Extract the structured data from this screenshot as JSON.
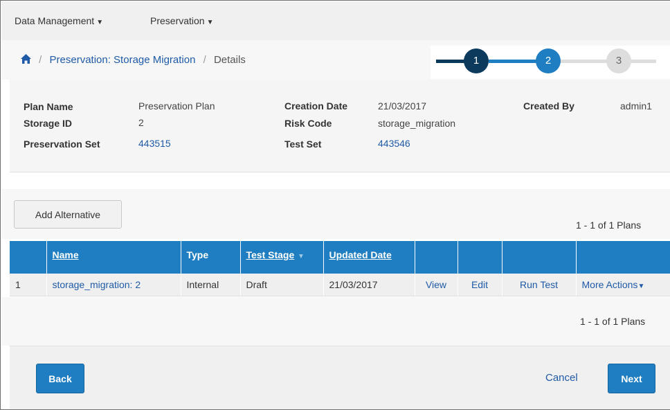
{
  "menu": {
    "items": [
      {
        "label": "Data Management"
      },
      {
        "label": "Preservation"
      }
    ]
  },
  "breadcrumb": {
    "link": "Preservation: Storage Migration",
    "current": "Details"
  },
  "stepper": {
    "steps": [
      "1",
      "2",
      "3"
    ],
    "colors": {
      "done": "#0b3a5c",
      "active": "#1f7ec1",
      "pending": "#dddddd"
    }
  },
  "info": {
    "plan_name_label": "Plan Name",
    "plan_name": "Preservation Plan",
    "storage_id_label": "Storage ID",
    "storage_id": "2",
    "preservation_set_label": "Preservation Set",
    "preservation_set": "443515",
    "creation_date_label": "Creation Date",
    "creation_date": "21/03/2017",
    "risk_code_label": "Risk Code",
    "risk_code": "storage_migration",
    "test_set_label": "Test Set",
    "test_set": "443546",
    "created_by_label": "Created By",
    "created_by": "admin1"
  },
  "toolbar": {
    "add_alternative": "Add Alternative",
    "count_top": "1 - 1 of 1 Plans",
    "count_bottom": "1 - 1 of 1 Plans"
  },
  "table": {
    "headers": {
      "name": "Name",
      "type": "Type",
      "test_stage": "Test Stage",
      "updated_date": "Updated Date"
    },
    "rows": [
      {
        "index": "1",
        "name": "storage_migration: 2",
        "type": "Internal",
        "test_stage": "Draft",
        "updated_date": "21/03/2017",
        "view": "View",
        "edit": "Edit",
        "run_test": "Run Test",
        "more_actions": "More Actions"
      }
    ]
  },
  "footer": {
    "back": "Back",
    "cancel": "Cancel",
    "next": "Next"
  },
  "colors": {
    "accent": "#1f7ec1",
    "link": "#1e5aa6",
    "dark_step": "#0b3a5c"
  }
}
